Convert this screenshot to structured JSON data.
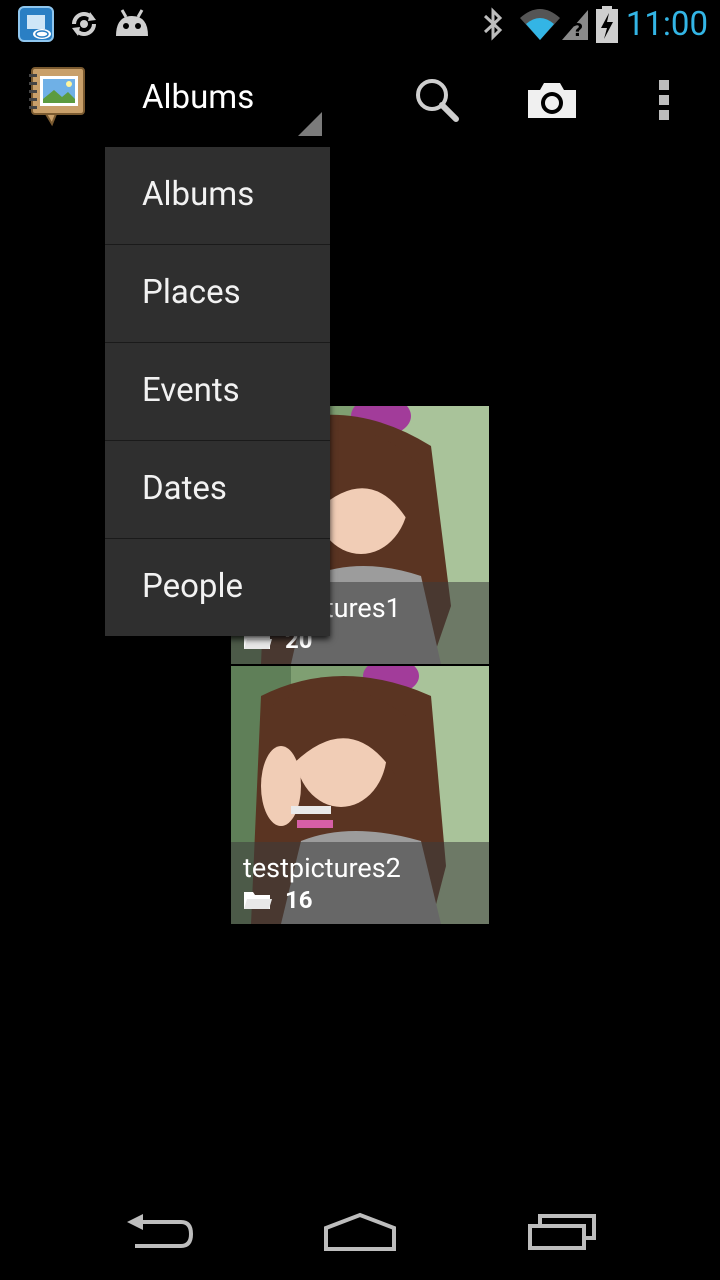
{
  "status_bar": {
    "time": "11:00",
    "icons": [
      "intel-app-icon",
      "sync-icon",
      "android-debug-icon",
      "bluetooth-icon",
      "wifi-icon",
      "no-sim-signal-icon",
      "battery-charging-icon"
    ]
  },
  "action_bar": {
    "app_icon": "gallery-notebook-icon",
    "spinner_label": "Albums",
    "actions": [
      "search-icon",
      "camera-icon",
      "overflow-menu-icon"
    ]
  },
  "dropdown": {
    "items": [
      "Albums",
      "Places",
      "Events",
      "Dates",
      "People"
    ]
  },
  "albums": [
    {
      "title": "testpictures1",
      "count": "20"
    },
    {
      "title": "testpictures2",
      "count": "16"
    }
  ],
  "nav_bar": {
    "buttons": [
      "back-icon",
      "home-icon",
      "recents-icon"
    ]
  },
  "colors": {
    "clock": "#33b5e5",
    "menu_bg": "#2f2f2f",
    "background": "#000000"
  }
}
